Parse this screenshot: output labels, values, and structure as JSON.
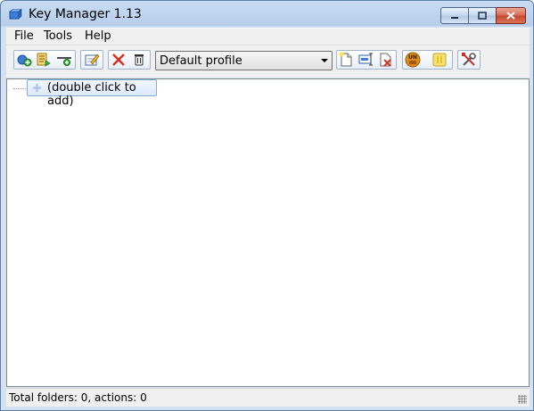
{
  "window": {
    "title": "Key Manager 1.13"
  },
  "menu": {
    "file": "File",
    "tools": "Tools",
    "help": "Help"
  },
  "toolbar": {
    "profile_selected": "Default profile",
    "icons": [
      "add-action-icon",
      "add-folder-icon",
      "add-separator-icon",
      "edit-icon",
      "delete-icon",
      "trash-icon",
      "new-profile-icon",
      "rename-profile-icon",
      "delete-profile-icon",
      "unmount-icon",
      "pause-icon",
      "settings-icon"
    ]
  },
  "tree": {
    "placeholder": "(double click to add)"
  },
  "status": {
    "text": "Total folders: 0, actions: 0"
  },
  "colors": {
    "accent": "#3b7dd8",
    "delete": "#d9301e",
    "pause": "#e8c21a",
    "unmount": "#e08a1c"
  }
}
